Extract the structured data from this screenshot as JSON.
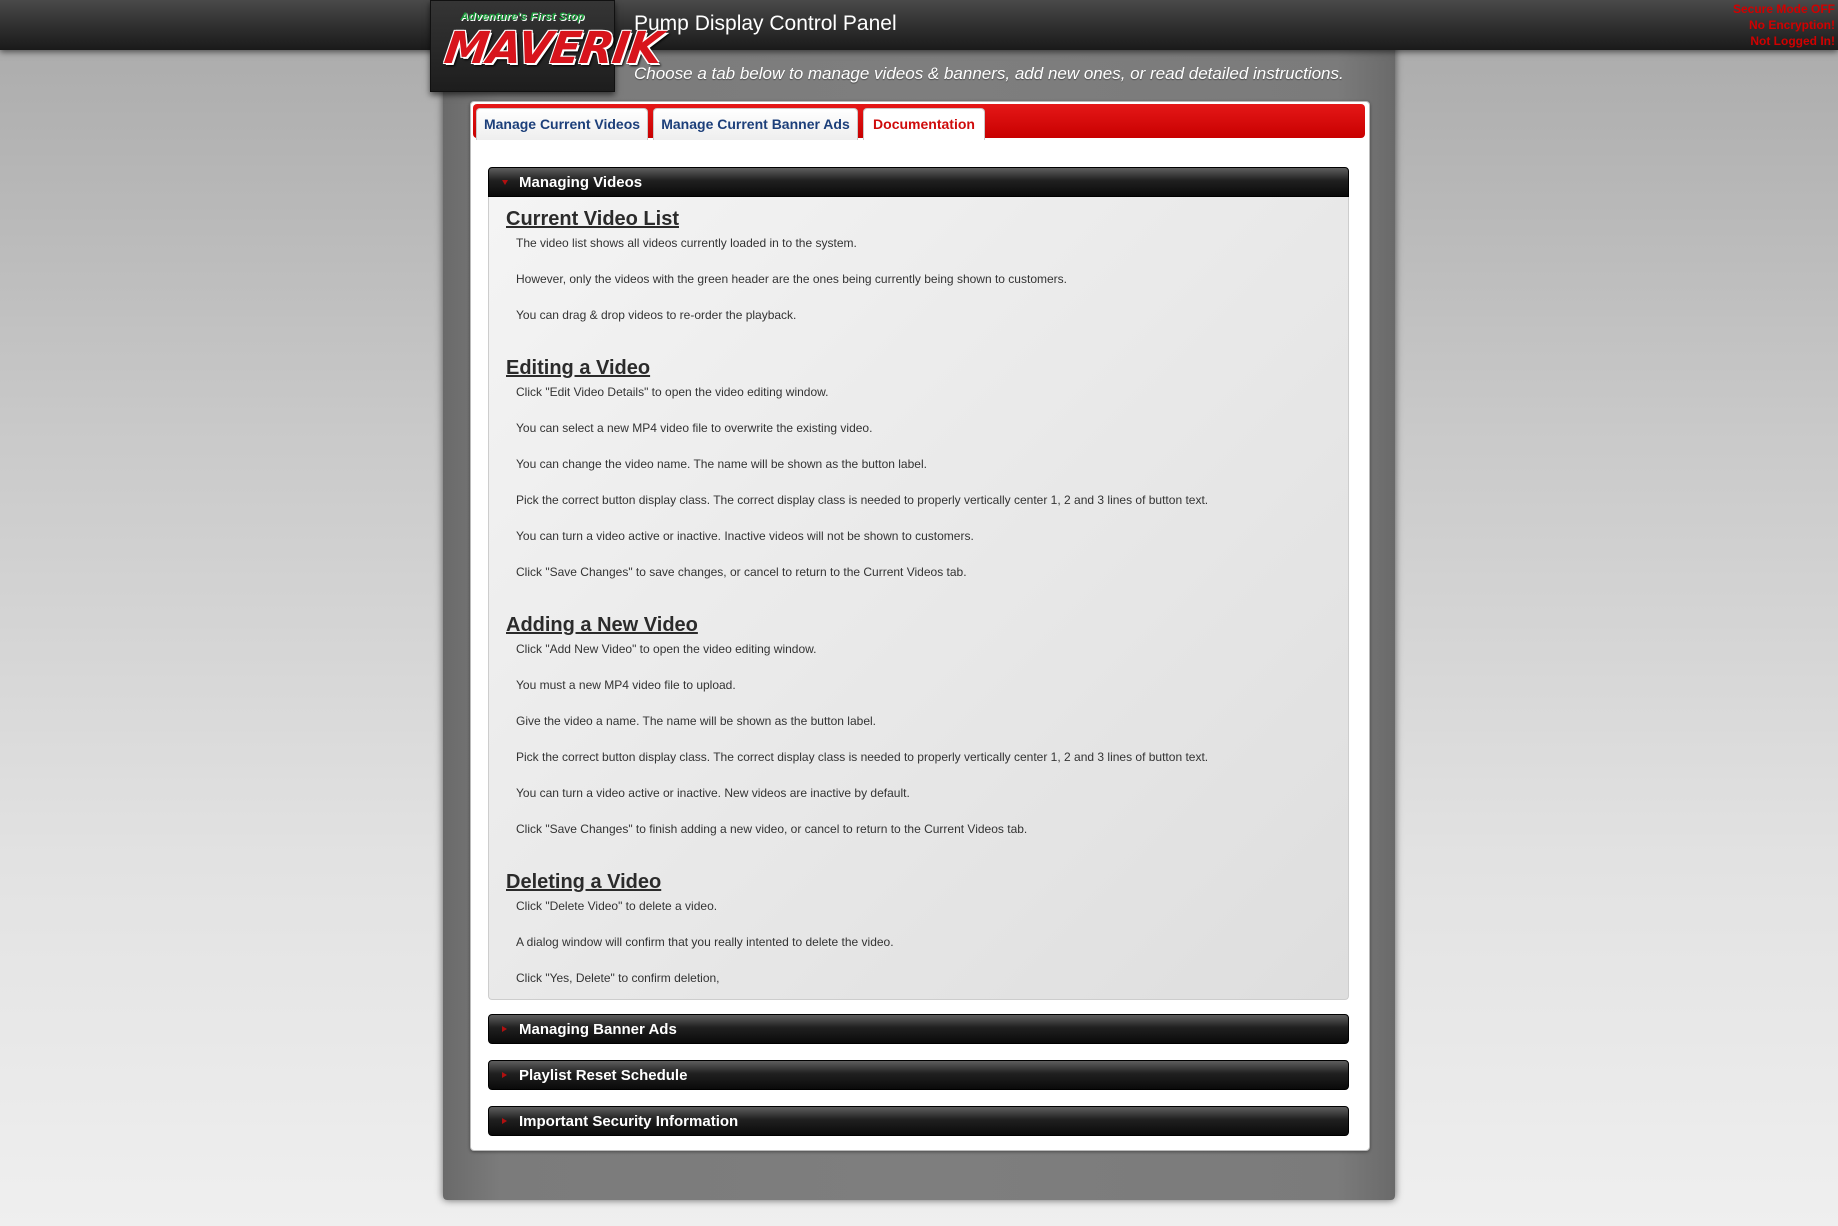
{
  "header": {
    "logo_tagline": "Adventure's First Stop",
    "logo_brand": "MAVERIK",
    "title": "Pump Display Control Panel",
    "subtitle": "Choose a tab below to manage videos & banners, add new ones, or read detailed instructions."
  },
  "status": {
    "secure_mode": "Secure Mode OFF",
    "encryption": "No Encryption!",
    "login": "Not Logged In!"
  },
  "tabs": [
    {
      "label": "Manage Current Videos",
      "active": false
    },
    {
      "label": "Manage Current Banner Ads",
      "active": false
    },
    {
      "label": "Documentation",
      "active": true
    }
  ],
  "accordion": [
    {
      "title": "Managing Videos",
      "open": true,
      "sections": [
        {
          "heading": "Current Video List",
          "paragraphs": [
            "The video list shows all videos currently loaded in to the system.",
            "However, only the videos with the green header are the ones being currently being shown to customers.",
            "You can drag & drop videos to re-order the playback."
          ]
        },
        {
          "heading": "Editing a Video",
          "paragraphs": [
            "Click \"Edit Video Details\" to open the video editing window.",
            "You can select a new MP4 video file to overwrite the existing video.",
            "You can change the video name. The name will be shown as the button label.",
            "Pick the correct button display class. The correct display class is needed to properly vertically center 1, 2 and 3 lines of button text.",
            "You can turn a video active or inactive. Inactive videos will not be shown to customers.",
            "Click \"Save Changes\" to save changes, or cancel to return to the Current Videos tab."
          ]
        },
        {
          "heading": "Adding a New Video",
          "paragraphs": [
            "Click \"Add New Video\" to open the video editing window.",
            "You must a new MP4 video file to upload.",
            "Give the video a name. The name will be shown as the button label.",
            "Pick the correct button display class. The correct display class is needed to properly vertically center 1, 2 and 3 lines of button text.",
            "You can turn a video active or inactive. New videos are inactive by default.",
            "Click \"Save Changes\" to finish adding a new video, or cancel to return to the Current Videos tab."
          ]
        },
        {
          "heading": "Deleting a Video",
          "paragraphs": [
            "Click \"Delete Video\" to delete a video.",
            "A dialog window will confirm that you really intented to delete the video.",
            "Click \"Yes, Delete\" to confirm deletion,"
          ]
        }
      ]
    },
    {
      "title": "Managing Banner Ads",
      "open": false
    },
    {
      "title": "Playlist Reset Schedule",
      "open": false
    },
    {
      "title": "Important Security Information",
      "open": false
    }
  ],
  "colors": {
    "accent_red": "#c80000",
    "tab_text_blue": "#1c3f7a",
    "status_red": "#d10000"
  }
}
